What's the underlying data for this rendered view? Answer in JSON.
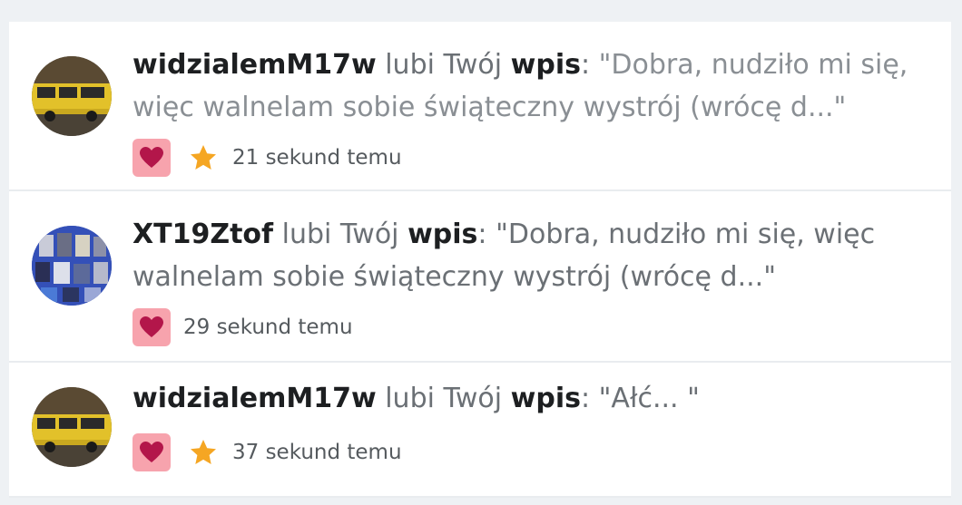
{
  "notifications": [
    {
      "user": "widzialemM17w",
      "verb": "lubi Twój",
      "object": "wpis",
      "colon": ":",
      "quote_line1": "\"Dobra, nudziło mi się,",
      "quote_line2": "więc walnelam sobie świąteczny wystrój (wrócę d...\"",
      "time": "21 sekund temu",
      "avatar": "bus-photo",
      "icons": [
        "heart-icon",
        "star-icon"
      ]
    },
    {
      "user": "XT19Ztof",
      "verb": "lubi Twój",
      "object": "wpis",
      "colon": ":",
      "quote_line1": "\"Dobra, nudziło mi się, więc",
      "quote_line2": "walnelam sobie świąteczny wystrój (wrócę d...\"",
      "time": "29 sekund temu",
      "avatar": "collage-photo",
      "icons": [
        "heart-icon"
      ]
    },
    {
      "user": "widzialemM17w",
      "verb": "lubi Twój",
      "object": "wpis",
      "colon": ":",
      "quote_line1": "\"Ałć... \"",
      "time": "37 sekund temu",
      "avatar": "bus-photo",
      "icons": [
        "heart-icon",
        "star-icon"
      ]
    }
  ],
  "colors": {
    "background": "#eef1f4",
    "card": "#ffffff",
    "heart_badge_bg": "#f7a3ad",
    "heart": "#b3164a",
    "star": "#f5a623",
    "username": "#1d1f21",
    "body_text": "#6b7075"
  }
}
